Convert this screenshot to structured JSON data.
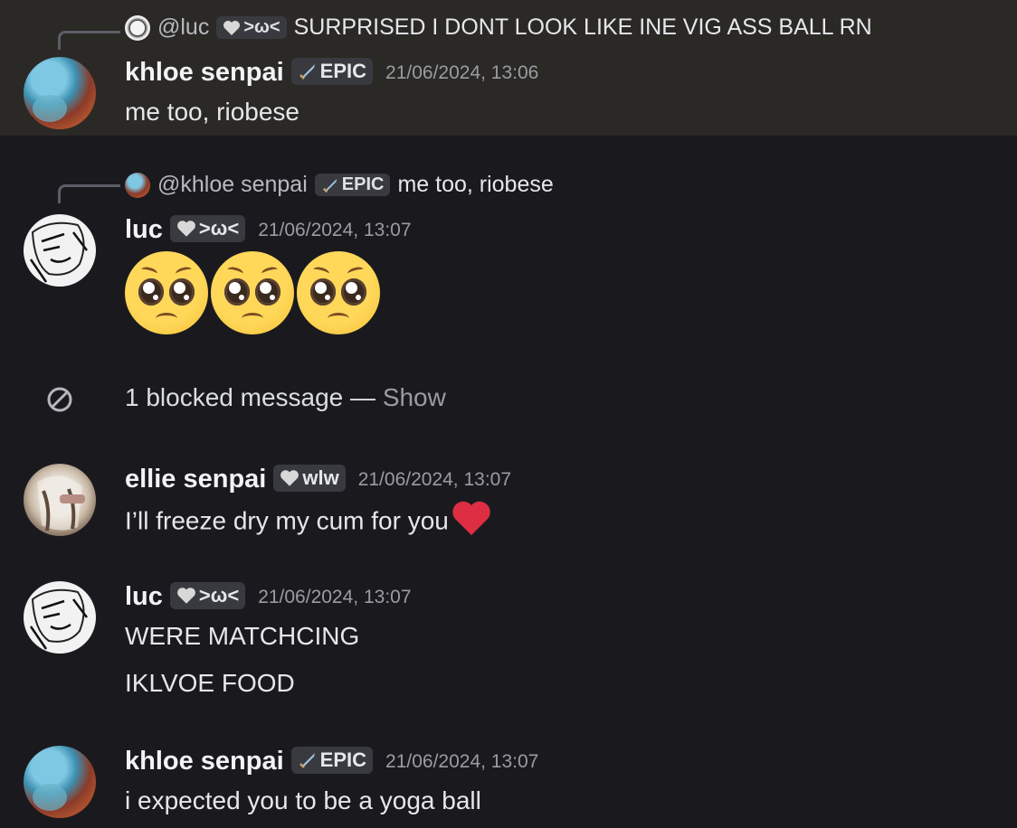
{
  "messages": [
    {
      "reply": {
        "author": "@luc",
        "badge": ">ω<",
        "text": "SURPRISED I DONT LOOK LIKE INE VIG ASS BALL RN"
      },
      "author": "khloe senpai",
      "badge": "EPIC",
      "timestamp": "21/06/2024, 13:06",
      "lines": [
        "me too, riobese"
      ]
    },
    {
      "reply": {
        "author": "@khloe senpai",
        "badge": "EPIC",
        "text": "me too, riobese"
      },
      "author": "luc",
      "badge": ">ω<",
      "timestamp": "21/06/2024, 13:07",
      "emojis": [
        "pleading-face",
        "pleading-face",
        "pleading-face"
      ]
    },
    {
      "author": "ellie senpai",
      "badge": "wlw",
      "timestamp": "21/06/2024, 13:07",
      "lines": [
        "I’ll freeze dry my cum for you"
      ],
      "trailing_emoji": "red-heart"
    },
    {
      "author": "luc",
      "badge": ">ω<",
      "timestamp": "21/06/2024, 13:07",
      "lines": [
        "WERE MATCHCING",
        "IKLVOE FOOD"
      ]
    },
    {
      "author": "khloe senpai",
      "badge": "EPIC",
      "timestamp": "21/06/2024, 13:07",
      "lines": [
        "i expected you to be a yoga ball"
      ]
    }
  ],
  "blocked": {
    "text": "1 blocked message — ",
    "action": "Show"
  },
  "colors": {
    "background": "#1a1a1e",
    "highlight": "#2b2926",
    "badge": "#393a40",
    "timestamp": "#9a9ca2",
    "heart": "#dd2e44"
  }
}
